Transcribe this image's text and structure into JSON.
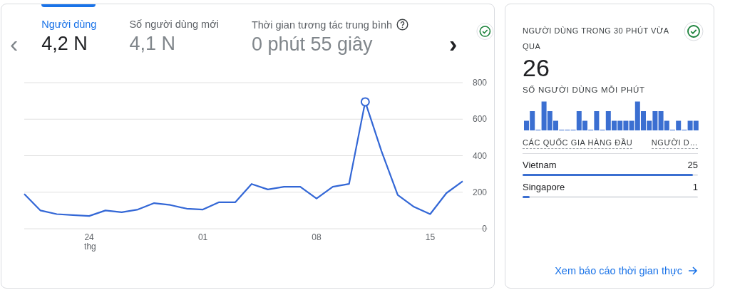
{
  "metrics_card": {
    "nav_prev": "‹",
    "nav_next": "›",
    "tabs": [
      {
        "label": "Người dùng",
        "value": "4,2 N",
        "selected": true,
        "help": false
      },
      {
        "label": "Số người dùng mới",
        "value": "4,1 N",
        "selected": false,
        "help": false
      },
      {
        "label": "Thời gian tương tác trung bình",
        "value": "0 phút 55 giây",
        "selected": false,
        "help": true
      }
    ],
    "status_ok": true,
    "month_label": "thg",
    "chart_data": {
      "type": "line",
      "categories": [
        null,
        null,
        null,
        null,
        "24",
        null,
        null,
        null,
        null,
        null,
        null,
        "01",
        null,
        null,
        null,
        null,
        null,
        null,
        "08",
        null,
        null,
        null,
        null,
        null,
        null,
        "15",
        null,
        null
      ],
      "series": [
        {
          "color": "#3367d6",
          "values": [
            190,
            100,
            80,
            75,
            70,
            100,
            90,
            105,
            140,
            130,
            110,
            105,
            145,
            145,
            245,
            215,
            230,
            230,
            165,
            230,
            245,
            695,
            425,
            185,
            120,
            80,
            195,
            260
          ]
        }
      ],
      "ylim": [
        0,
        800
      ],
      "yticks": [
        0,
        200,
        400,
        600,
        800
      ],
      "grid": true
    }
  },
  "realtime_card": {
    "title": "NGƯỜI DÙNG TRONG 30 PHÚT VỪA QUA",
    "status_ok": true,
    "value": "26",
    "subtitle": "SỐ NGƯỜI DÙNG MỖI PHÚT",
    "columns": [
      "CÁC QUỐC GIA HÀNG ĐẦU",
      "NGƯỜI D…"
    ],
    "rows": [
      {
        "country": "Vietnam",
        "users": "25",
        "level": 0.97
      },
      {
        "country": "Singapore",
        "users": "1",
        "level": 0.04
      }
    ],
    "link": "Xem báo cáo thời gian thực"
  }
}
